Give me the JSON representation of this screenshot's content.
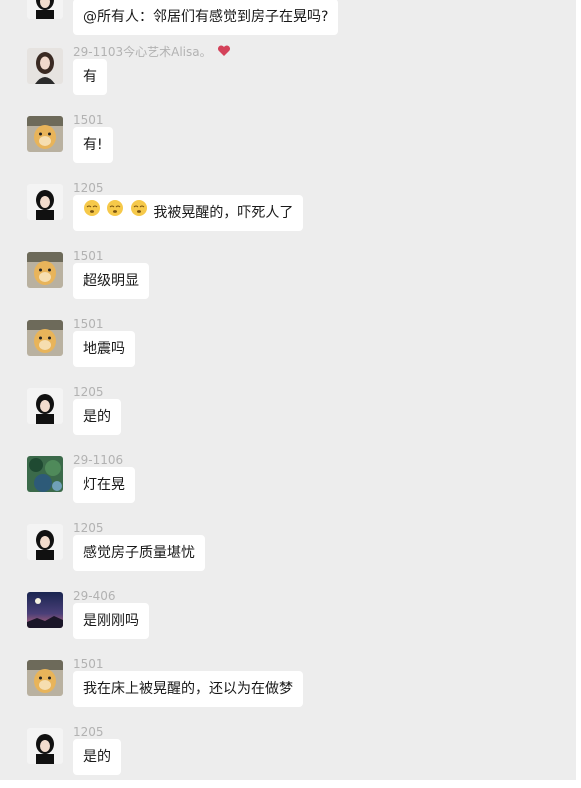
{
  "top_message": {
    "text": "@所有人：邻居们有感觉到房子在晃吗?"
  },
  "messages": [
    {
      "sender": "29-1103今心艺术Alisa。",
      "text": "有"
    },
    {
      "sender": "1501",
      "text": "有!"
    },
    {
      "sender": "1205",
      "text": "我被晃醒的，吓死人了",
      "emoji_count": 3
    },
    {
      "sender": "1501",
      "text": "超级明显"
    },
    {
      "sender": "1501",
      "text": "地震吗"
    },
    {
      "sender": "1205",
      "text": "是的"
    },
    {
      "sender": "29-1106",
      "text": "灯在晃"
    },
    {
      "sender": "1205",
      "text": "感觉房子质量堪忧"
    },
    {
      "sender": "29-406",
      "text": "是刚刚吗"
    },
    {
      "sender": "1501",
      "text": "我在床上被晃醒的，还以为在做梦"
    },
    {
      "sender": "1205",
      "text": "是的"
    }
  ],
  "icons": {
    "sender_badge": "red-heart-icon",
    "reaction_emoji": "sleepy-face-emoji-icon"
  },
  "colors": {
    "chat_background": "#ededed",
    "bubble": "#ffffff",
    "sender_name": "#b2b2b2",
    "message_text": "#191919",
    "heart": "#d4425a"
  }
}
